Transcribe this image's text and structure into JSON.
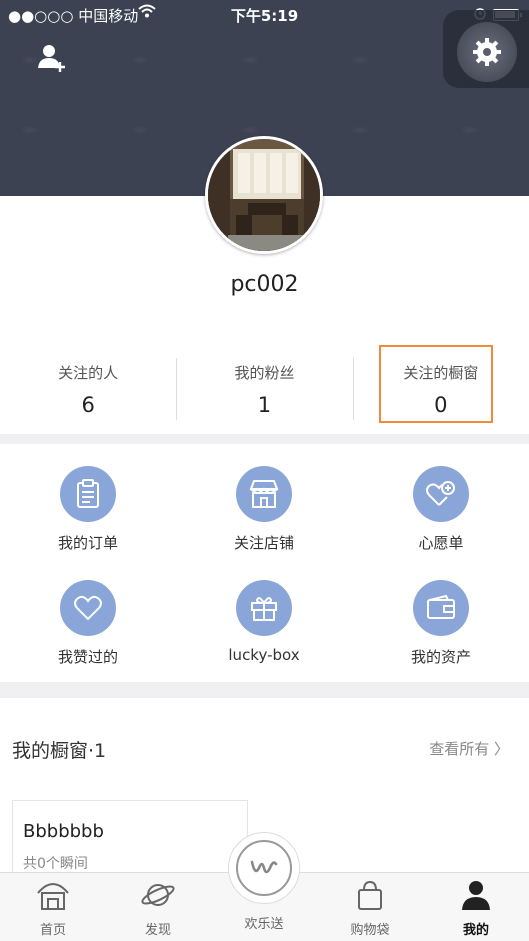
{
  "status_bar": {
    "carrier": "●●○○○ 中国移动",
    "time": "下午5:19"
  },
  "profile": {
    "username": "pc002"
  },
  "stats": [
    {
      "label": "关注的人",
      "value": "6"
    },
    {
      "label": "我的粉丝",
      "value": "1"
    },
    {
      "label": "关注的橱窗",
      "value": "0"
    }
  ],
  "grid": [
    {
      "label": "我的订单",
      "icon": "clipboard-icon"
    },
    {
      "label": "关注店铺",
      "icon": "store-icon"
    },
    {
      "label": "心愿单",
      "icon": "heart-plus-icon"
    },
    {
      "label": "我赞过的",
      "icon": "heart-icon"
    },
    {
      "label": "lucky-box",
      "icon": "gift-box-icon"
    },
    {
      "label": "我的资产",
      "icon": "wallet-icon"
    }
  ],
  "showcase": {
    "title": "我的橱窗·1",
    "more": "查看所有 〉",
    "card_title": "Bbbbbbb",
    "card_sub": "共0个瞬间"
  },
  "tabbar": [
    {
      "label": "首页",
      "icon": "home-icon"
    },
    {
      "label": "发现",
      "icon": "planet-icon"
    },
    {
      "label": "欢乐送",
      "icon": "center-logo-icon"
    },
    {
      "label": "购物袋",
      "icon": "bag-icon"
    },
    {
      "label": "我的",
      "icon": "person-icon"
    }
  ],
  "colors": {
    "header_bg": "#3d4252",
    "icon_circle": "#8aa6d8",
    "highlight": "#f08a3c"
  }
}
